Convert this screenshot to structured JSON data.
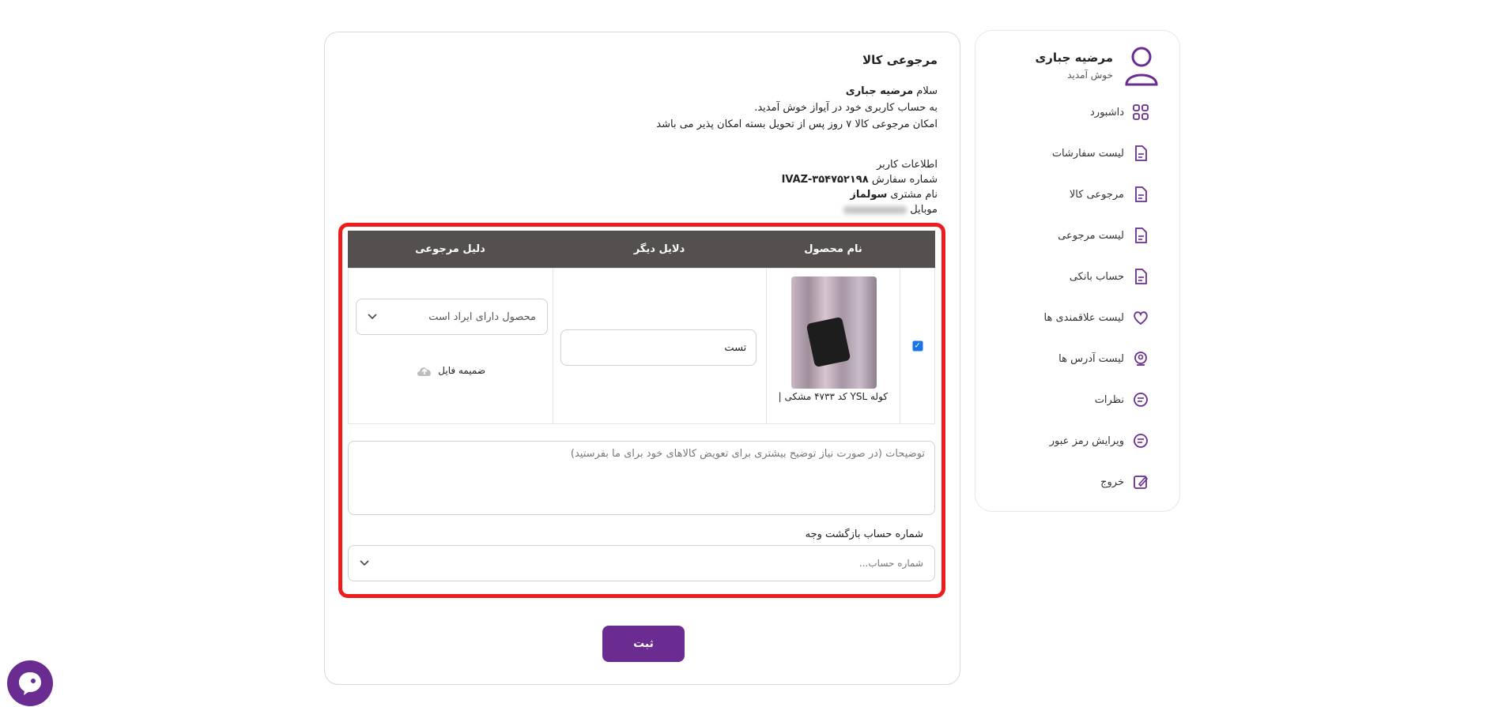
{
  "colors": {
    "accent": "#6a2c91",
    "highlight": "#ee1c1c",
    "table_header": "#555050"
  },
  "sidebar": {
    "profile_name": "مرضیه جباری",
    "profile_sub": "خوش آمدید",
    "items": [
      {
        "label": "داشبورد",
        "icon": "grid-icon"
      },
      {
        "label": "لیست سفارشات",
        "icon": "document-icon"
      },
      {
        "label": "مرجوعی کالا",
        "icon": "document-icon"
      },
      {
        "label": "لیست مرجوعی",
        "icon": "document-icon"
      },
      {
        "label": "حساب بانکی",
        "icon": "document-icon"
      },
      {
        "label": "لیست علاقمندی ها",
        "icon": "heart-icon"
      },
      {
        "label": "لیست آدرس ها",
        "icon": "location-icon"
      },
      {
        "label": "نظرات",
        "icon": "comment-icon"
      },
      {
        "label": "ویرایش رمز عبور",
        "icon": "comment-icon"
      },
      {
        "label": "خروج",
        "icon": "edit-icon"
      }
    ]
  },
  "main": {
    "title": "مرجوعی کالا",
    "greeting_prefix": "سلام",
    "greeting_name": "مرضیه جباری",
    "welcome": "به حساب کاربری خود در آیواز خوش آمدید.",
    "return_policy": "امکان مرجوعی کالا ۷ روز پس از تحویل بسته امکان پذیر می باشد",
    "user_info_label": "اطلاعات کاربر",
    "order_label": "شماره سفارش",
    "order_number": "IVAZ-۳۵۴۷۵۲۱۹۸",
    "customer_label": "نام مشتری",
    "customer_name": "سولماز",
    "mobile_label": "موبایل"
  },
  "table": {
    "headers": [
      "نام محصول",
      "دلایل دیگر",
      "دلیل مرجوعی"
    ],
    "row": {
      "checked": true,
      "product_name": "کوله YSL کد ۴۷۳۳ مشکی |",
      "other_reason": "تست",
      "return_reason": "محصول دارای ایراد است",
      "attach_label": "ضمیمه فایل"
    }
  },
  "description_placeholder": "توضیحات (در صورت نیاز توضیح بیشتری برای تعویض کالاهای خود برای ما بفرستید)",
  "account": {
    "label": "شماره حساب بازگشت وجه",
    "placeholder": "شماره حساب..."
  },
  "submit_label": "ثبت"
}
